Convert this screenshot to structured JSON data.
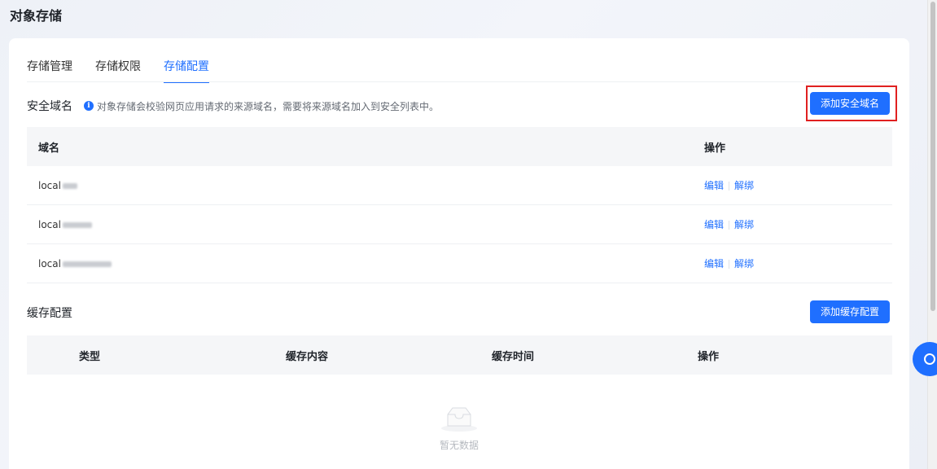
{
  "page": {
    "title": "对象存储"
  },
  "tabs": [
    {
      "label": "存储管理",
      "active": false
    },
    {
      "label": "存储权限",
      "active": false
    },
    {
      "label": "存储配置",
      "active": true
    }
  ],
  "security": {
    "title": "安全域名",
    "hint": "对象存储会校验网页应用请求的来源域名，需要将来源域名加入到安全列表中。",
    "add_button": "添加安全域名",
    "columns": {
      "domain": "域名",
      "action": "操作"
    },
    "rows": [
      {
        "domain": "local",
        "edit": "编辑",
        "unbind": "解绑"
      },
      {
        "domain": "local",
        "edit": "编辑",
        "unbind": "解绑"
      },
      {
        "domain": "local",
        "edit": "编辑",
        "unbind": "解绑"
      }
    ]
  },
  "cache": {
    "title": "缓存配置",
    "add_button": "添加缓存配置",
    "columns": {
      "type": "类型",
      "content": "缓存内容",
      "time": "缓存时间",
      "action": "操作"
    },
    "empty_text": "暂无数据"
  },
  "colors": {
    "accent": "#1f6fff",
    "highlight": "#e02020"
  }
}
